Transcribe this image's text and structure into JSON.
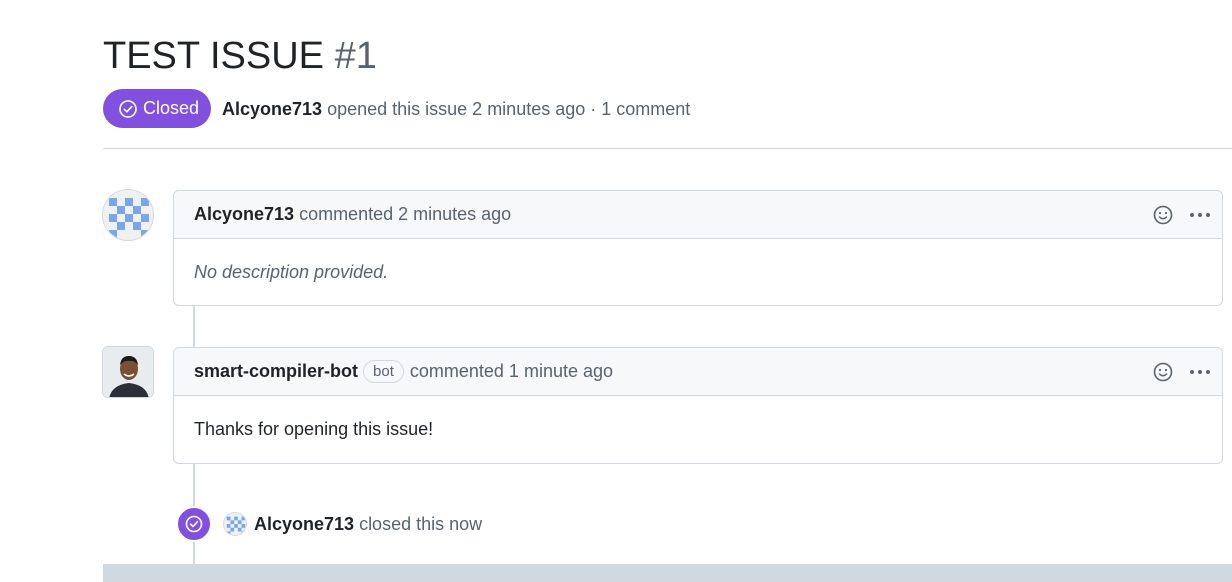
{
  "issue": {
    "title": "TEST ISSUE",
    "number": "#1",
    "state": "Closed",
    "state_color": "#8250df",
    "author": "Alcyone713",
    "meta_text": "opened this issue 2 minutes ago · 1 comment"
  },
  "comments": [
    {
      "author": "Alcyone713",
      "action": "commented 2 minutes ago",
      "body": "No description provided.",
      "avatar": "identicon-avatar"
    },
    {
      "author": "smart-compiler-bot",
      "badge": "bot",
      "action": "commented 1 minute ago",
      "body": "Thanks for opening this issue!",
      "avatar": "photo-avatar"
    }
  ],
  "event": {
    "icon": "check-circle-icon",
    "author": "Alcyone713",
    "text": "closed this now"
  },
  "icons": {
    "reaction": "smiley-icon",
    "more": "kebab-horizontal-icon"
  }
}
